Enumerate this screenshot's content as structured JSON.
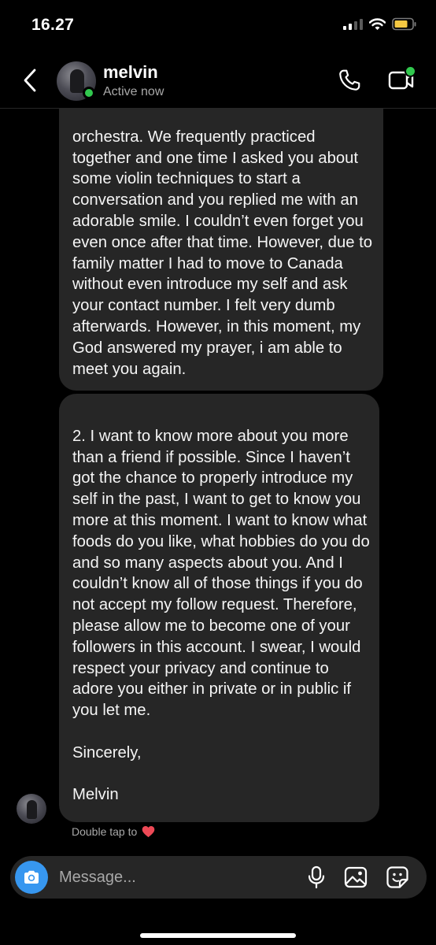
{
  "status_bar": {
    "time": "16.27"
  },
  "header": {
    "name": "melvin",
    "status": "Active now"
  },
  "messages": [
    {
      "text": "orchestra. We frequently practiced together and one time I asked you about some violin techniques to start a conversation and you replied me with an adorable smile. I couldn’t even forget you even once after that time. However, due to family matter I had to move to Canada without even introduce my self and ask your contact number. I felt very dumb afterwards. However, in this moment, my God answered my prayer, i am able to meet you again."
    },
    {
      "text": "2. I want to know more about you more than a friend if possible. Since I haven’t got the chance to properly introduce my self in the past, I want to get to know you more at this moment. I want to know what foods do you like, what hobbies do you do and so many aspects about you. And I couldn’t know all of those things if you do not accept my follow request. Therefore, please allow me to become one of your followers in this account. I swear, I would respect your privacy and continue to adore you either in private or in public if you let me.\n\nSincerely,\n\nMelvin"
    }
  ],
  "hint": {
    "text": "Double tap to",
    "icon": "heart-icon"
  },
  "composer": {
    "placeholder": "Message..."
  },
  "colors": {
    "background": "#000000",
    "bubble": "#262626",
    "accent": "#3797f0",
    "online": "#31c84e",
    "heart": "#ed4956",
    "battery": "#f5c842"
  }
}
